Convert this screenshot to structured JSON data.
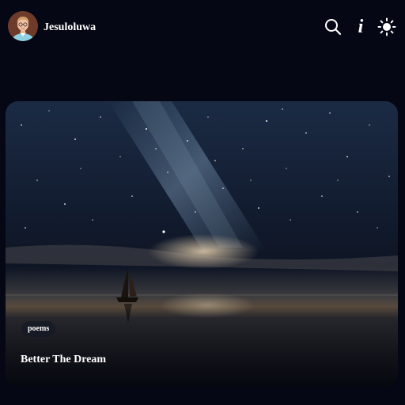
{
  "header": {
    "username": "Jesuloluwa",
    "icons": [
      "search-icon",
      "info-icon",
      "sun-icon"
    ],
    "info_glyph": "i"
  },
  "post": {
    "tag": "poems",
    "title": "Better The Dream"
  },
  "colors": {
    "background": "#050814",
    "text": "#ffffff"
  }
}
